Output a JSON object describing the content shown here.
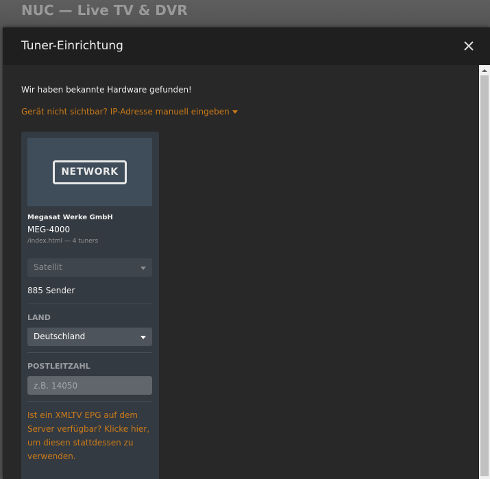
{
  "background": {
    "title": "NUC — Live TV & DVR"
  },
  "modal": {
    "title": "Tuner-Einrichtung",
    "close_icon": "close-icon",
    "found_text": "Wir haben bekannte Hardware gefunden!",
    "manual_ip_link": "Gerät nicht sichtbar? IP-Adresse manuell eingeben"
  },
  "device": {
    "image_label": "NETWORK",
    "manufacturer": "Megasat Werke GmbH",
    "model": "MEG-4000",
    "meta": "/index.html — 4 tuners",
    "source_type": "Satellit",
    "channel_count": "885 Sender",
    "country_label": "LAND",
    "country_value": "Deutschland",
    "zip_label": "POSTLEITZAHL",
    "zip_placeholder": "z.B. 14050",
    "xmltv_link": "Ist ein XMLTV EPG auf dem Server verfügbar? Klicke hier, um diesen stattdessen zu verwenden."
  },
  "colors": {
    "accent": "#cc7b19",
    "modal_bg": "#282828",
    "card_bg": "#343a41"
  }
}
